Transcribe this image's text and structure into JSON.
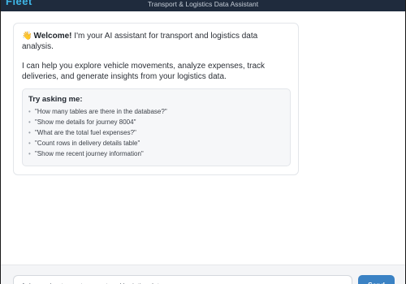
{
  "header": {
    "logo": "Fleet",
    "subtitle": "Transport & Logistics Data Assistant"
  },
  "message": {
    "wave_icon": "waving-hand-icon",
    "welcome_bold": "Welcome!",
    "welcome_text": " I'm your AI assistant for transport and logistics data analysis.",
    "intro": "I can help you explore vehicle movements, analyze expenses, track deliveries, and generate insights from your logistics data.",
    "tips_title": "Try asking me:",
    "tips": [
      "\"How many tables are there in the database?\"",
      "\"Show me details for journey 8004\"",
      "\"What are the total fuel expenses?\"",
      "\"Count rows in delivery details table\"",
      "\"Show me recent journey information\""
    ]
  },
  "composer": {
    "placeholder": "Ask me about your transport and logistics data...",
    "send_label": "Send"
  },
  "colors": {
    "header_bg": "#1f2b3d",
    "accent": "#3b82c4",
    "logo": "#3fb7e8"
  }
}
